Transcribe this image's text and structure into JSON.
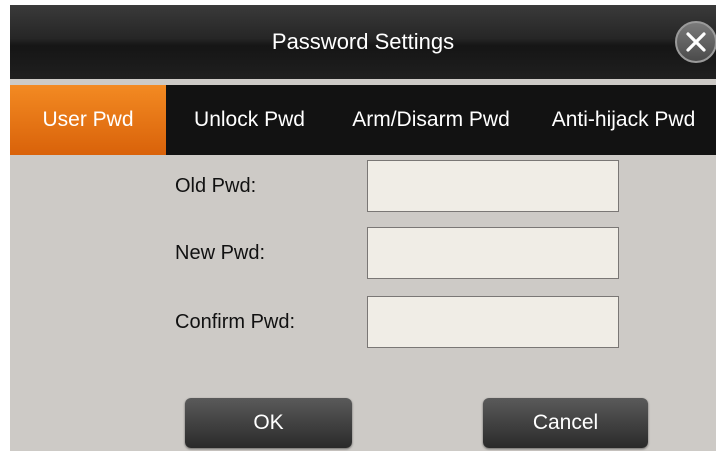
{
  "dialog": {
    "title": "Password Settings",
    "close_icon": "close-icon"
  },
  "tabs": [
    {
      "label": "User Pwd",
      "active": true
    },
    {
      "label": "Unlock Pwd",
      "active": false
    },
    {
      "label": "Arm/Disarm Pwd",
      "active": false
    },
    {
      "label": "Anti-hijack Pwd",
      "active": false
    }
  ],
  "form": {
    "old_label": "Old Pwd:",
    "old_value": "",
    "new_label": "New Pwd:",
    "new_value": "",
    "confirm_label": "Confirm Pwd:",
    "confirm_value": ""
  },
  "buttons": {
    "ok": "OK",
    "cancel": "Cancel"
  },
  "colors": {
    "accent": "#f38a22",
    "panel": "#cdcac6",
    "field": "#f0ede6",
    "titlebar": "#1f1f1f"
  }
}
